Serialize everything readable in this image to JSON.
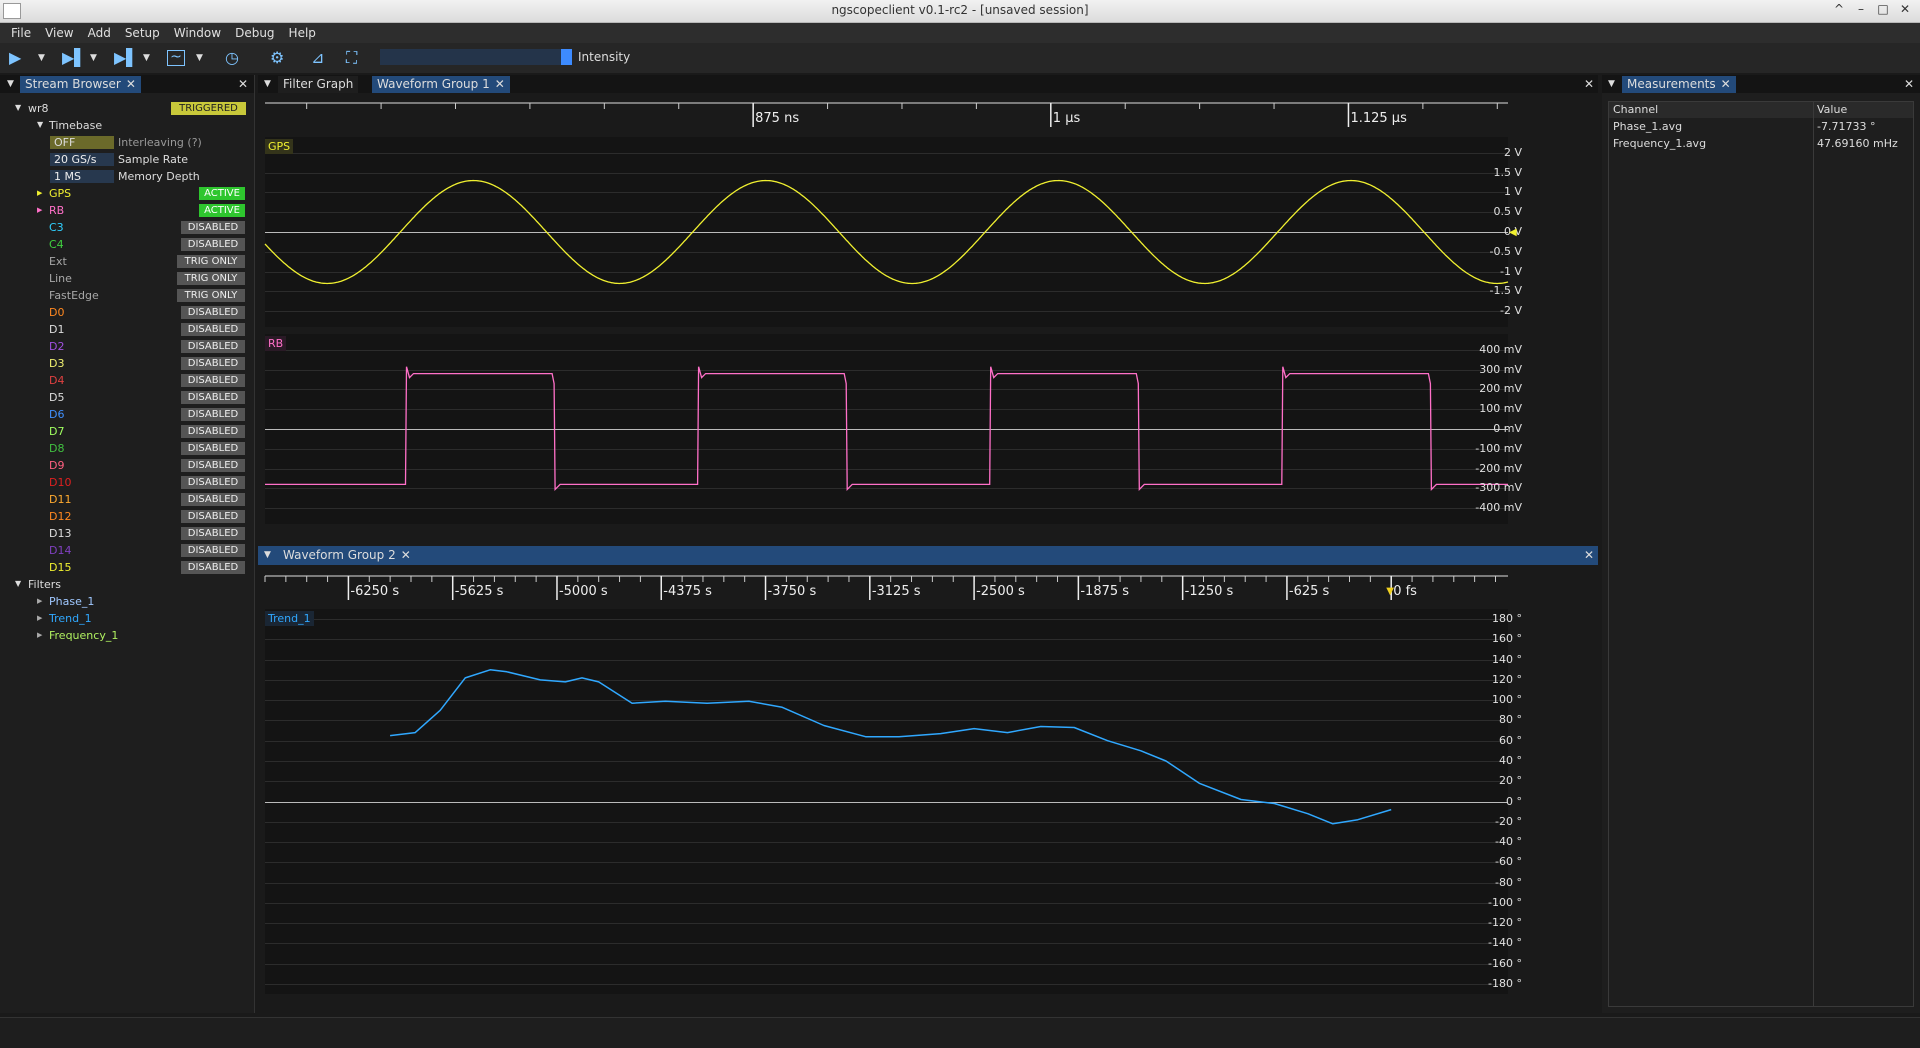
{
  "window": {
    "title": "ngscopeclient v0.1-rc2  - [unsaved session]"
  },
  "menu": [
    "File",
    "View",
    "Add",
    "Setup",
    "Window",
    "Debug",
    "Help"
  ],
  "toolbar": {
    "intensity_label": "Intensity"
  },
  "stream_browser": {
    "tab": "Stream Browser",
    "instrument": "wr8",
    "instrument_status": "TRIGGERED",
    "timebase": {
      "label": "Timebase",
      "interleaving_value": "OFF",
      "interleaving_label": "Interleaving",
      "interleaving_help": "(?)",
      "sample_rate_value": "20 GS/s",
      "sample_rate_label": "Sample Rate",
      "memory_depth_value": "1 MS",
      "memory_depth_label": "Memory Depth"
    },
    "channels": [
      {
        "name": "GPS",
        "status": "ACTIVE",
        "kind": "active",
        "color": "#f0f030",
        "expand": true
      },
      {
        "name": "RB",
        "status": "ACTIVE",
        "kind": "active",
        "color": "#ff70c8",
        "expand": true
      },
      {
        "name": "C3",
        "status": "DISABLED",
        "kind": "disabled",
        "color": "#30d0ff"
      },
      {
        "name": "C4",
        "status": "DISABLED",
        "kind": "disabled",
        "color": "#40d040"
      },
      {
        "name": "Ext",
        "status": "TRIG ONLY",
        "kind": "trig",
        "color": "#a8a8a8"
      },
      {
        "name": "Line",
        "status": "TRIG ONLY",
        "kind": "trig",
        "color": "#a8a8a8"
      },
      {
        "name": "FastEdge",
        "status": "TRIG ONLY",
        "kind": "trig",
        "color": "#a8a8a8"
      },
      {
        "name": "D0",
        "status": "DISABLED",
        "kind": "disabled",
        "color": "#ff8820"
      },
      {
        "name": "D1",
        "status": "DISABLED",
        "kind": "disabled",
        "color": "#dddddd"
      },
      {
        "name": "D2",
        "status": "DISABLED",
        "kind": "disabled",
        "color": "#a050e0"
      },
      {
        "name": "D3",
        "status": "DISABLED",
        "kind": "disabled",
        "color": "#f0f070"
      },
      {
        "name": "D4",
        "status": "DISABLED",
        "kind": "disabled",
        "color": "#e04040"
      },
      {
        "name": "D5",
        "status": "DISABLED",
        "kind": "disabled",
        "color": "#dddddd"
      },
      {
        "name": "D6",
        "status": "DISABLED",
        "kind": "disabled",
        "color": "#4090ff"
      },
      {
        "name": "D7",
        "status": "DISABLED",
        "kind": "disabled",
        "color": "#a0ff60"
      },
      {
        "name": "D8",
        "status": "DISABLED",
        "kind": "disabled",
        "color": "#40c040"
      },
      {
        "name": "D9",
        "status": "DISABLED",
        "kind": "disabled",
        "color": "#ff6080"
      },
      {
        "name": "D10",
        "status": "DISABLED",
        "kind": "disabled",
        "color": "#e02020"
      },
      {
        "name": "D11",
        "status": "DISABLED",
        "kind": "disabled",
        "color": "#ffaa30"
      },
      {
        "name": "D12",
        "status": "DISABLED",
        "kind": "disabled",
        "color": "#ff8820"
      },
      {
        "name": "D13",
        "status": "DISABLED",
        "kind": "disabled",
        "color": "#dddddd"
      },
      {
        "name": "D14",
        "status": "DISABLED",
        "kind": "disabled",
        "color": "#8040c0"
      },
      {
        "name": "D15",
        "status": "DISABLED",
        "kind": "disabled",
        "color": "#f0f030"
      }
    ],
    "filters_label": "Filters",
    "filters": [
      {
        "name": "Phase_1",
        "color": "#a0c8ff"
      },
      {
        "name": "Trend_1",
        "color": "#30a8ff"
      },
      {
        "name": "Frequency_1",
        "color": "#b0f060"
      }
    ]
  },
  "center_tabs": {
    "filter_graph": "Filter Graph",
    "waveform_group_1": "Waveform Group 1"
  },
  "group1": {
    "time_ticks": [
      {
        "label": "875 ns",
        "t": 875
      },
      {
        "label": "1 µs",
        "t": 1000
      },
      {
        "label": "1.125 µs",
        "t": 1125
      }
    ],
    "gps": {
      "label": "GPS",
      "color": "#f0f030",
      "axis_labels": [
        "2 V",
        "1.5 V",
        "1 V",
        "0.5 V",
        "0 V",
        "-0.5 V",
        "-1 V",
        "-1.5 V",
        "-2 V"
      ],
      "axis_values": [
        2,
        1.5,
        1,
        0.5,
        0,
        -0.5,
        -1,
        -1.5,
        -2
      ],
      "amplitude_v": 1.3,
      "cycles_visible": 4.25,
      "first_trough_fraction": 0.05
    },
    "rb": {
      "label": "RB",
      "color": "#ff70c8",
      "axis_labels": [
        "400 mV",
        "300 mV",
        "200 mV",
        "100 mV",
        "0 mV",
        "-100 mV",
        "-200 mV",
        "-300 mV",
        "-400 mV"
      ],
      "axis_values": [
        400,
        300,
        200,
        100,
        0,
        -100,
        -200,
        -300,
        -400
      ],
      "high_mv": 280,
      "low_mv": -280,
      "rising_edges_fraction": [
        0.113,
        0.348,
        0.583,
        0.818
      ],
      "falling_edges_fraction": [
        0.231,
        0.466,
        0.701,
        0.936
      ]
    }
  },
  "group2": {
    "tab": "Waveform Group 2",
    "time_ticks": [
      {
        "label": "-6250 s",
        "t": -6250
      },
      {
        "label": "-5625 s",
        "t": -5625
      },
      {
        "label": "-5000 s",
        "t": -5000
      },
      {
        "label": "-4375 s",
        "t": -4375
      },
      {
        "label": "-3750 s",
        "t": -3750
      },
      {
        "label": "-3125 s",
        "t": -3125
      },
      {
        "label": "-2500 s",
        "t": -2500
      },
      {
        "label": "-1875 s",
        "t": -1875
      },
      {
        "label": "-1250 s",
        "t": -1250
      },
      {
        "label": "-625 s",
        "t": -625
      },
      {
        "label": "0 fs",
        "t": 0
      }
    ],
    "trend": {
      "label": "Trend_1",
      "color": "#30a8ff",
      "axis_labels": [
        "180 °",
        "160 °",
        "140 °",
        "120 °",
        "100 °",
        "80 °",
        "60 °",
        "40 °",
        "20 °",
        "0 °",
        "-20 °",
        "-40 °",
        "-60 °",
        "-80 °",
        "-100 °",
        "-120 °",
        "-140 °",
        "-160 °",
        "-180 °"
      ],
      "axis_values": [
        180,
        160,
        140,
        120,
        100,
        80,
        60,
        40,
        20,
        0,
        -20,
        -40,
        -60,
        -80,
        -100,
        -120,
        -140,
        -160,
        -180
      ],
      "points": [
        [
          -6000,
          65
        ],
        [
          -5850,
          68
        ],
        [
          -5700,
          90
        ],
        [
          -5550,
          122
        ],
        [
          -5400,
          130
        ],
        [
          -5300,
          128
        ],
        [
          -5100,
          120
        ],
        [
          -4950,
          118
        ],
        [
          -4850,
          122
        ],
        [
          -4750,
          118
        ],
        [
          -4550,
          97
        ],
        [
          -4350,
          99
        ],
        [
          -4100,
          97
        ],
        [
          -3850,
          99
        ],
        [
          -3650,
          93
        ],
        [
          -3400,
          75
        ],
        [
          -3150,
          64
        ],
        [
          -2950,
          64
        ],
        [
          -2700,
          67
        ],
        [
          -2500,
          72
        ],
        [
          -2300,
          68
        ],
        [
          -2100,
          74
        ],
        [
          -1900,
          73
        ],
        [
          -1700,
          60
        ],
        [
          -1500,
          50
        ],
        [
          -1350,
          40
        ],
        [
          -1150,
          18
        ],
        [
          -900,
          2
        ],
        [
          -700,
          -2
        ],
        [
          -500,
          -12
        ],
        [
          -350,
          -22
        ],
        [
          -200,
          -18
        ],
        [
          0,
          -8
        ]
      ]
    }
  },
  "measurements": {
    "tab": "Measurements",
    "headers": [
      "Channel",
      "Value"
    ],
    "rows": [
      {
        "channel": "Phase_1.avg",
        "value": "-7.71733 °"
      },
      {
        "channel": "Frequency_1.avg",
        "value": "47.69160 mHz"
      }
    ]
  }
}
